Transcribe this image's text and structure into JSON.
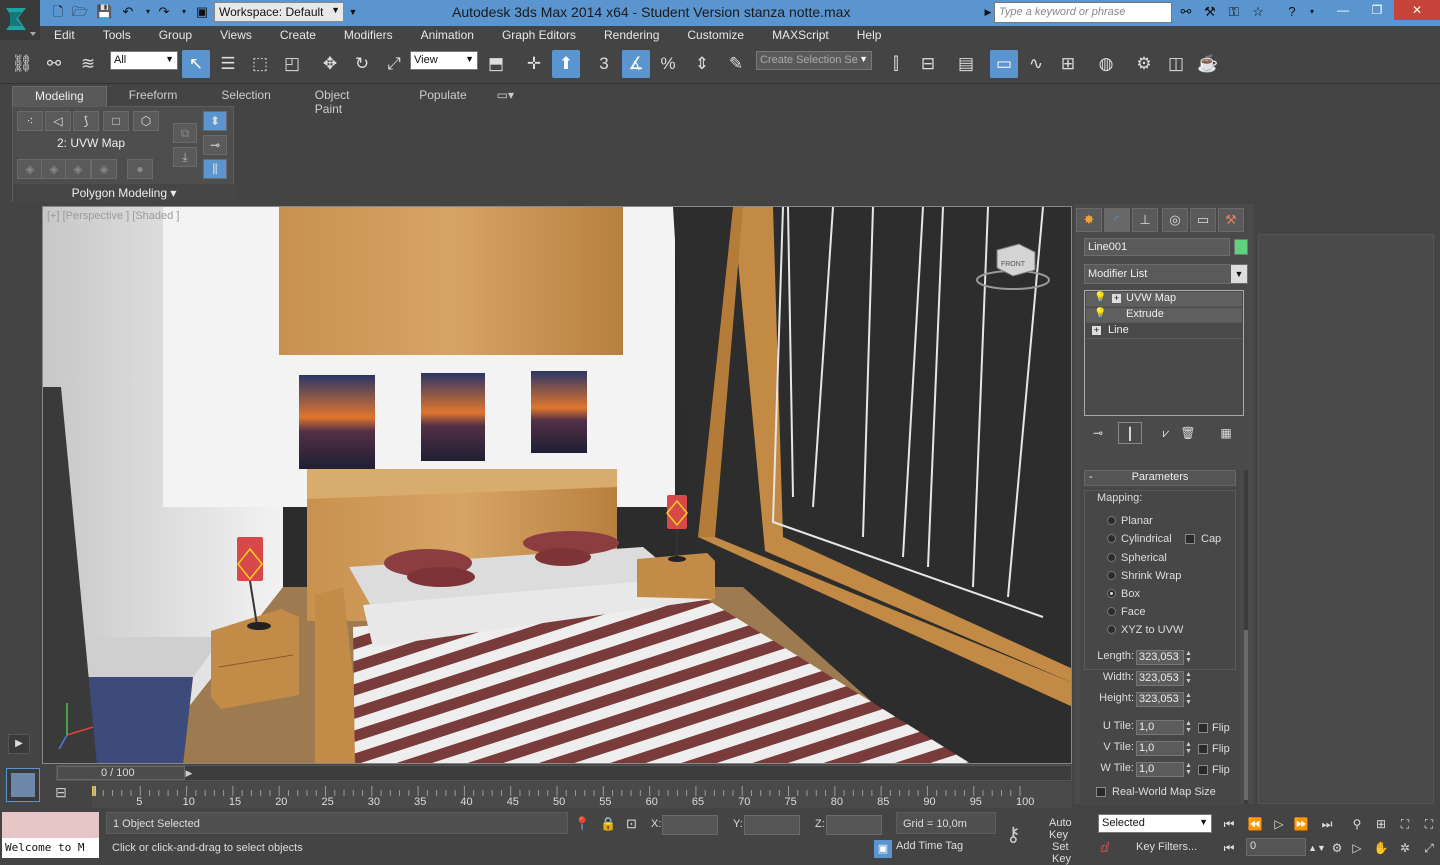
{
  "titlebar": {
    "title": "Autodesk 3ds Max  2014 x64   - Student Version    stanza notte.max",
    "workspace": "Workspace: Default",
    "search_placeholder": "Type a keyword or phrase"
  },
  "menu": [
    "Edit",
    "Tools",
    "Group",
    "Views",
    "Create",
    "Modifiers",
    "Animation",
    "Graph Editors",
    "Rendering",
    "Customize",
    "MAXScript",
    "Help"
  ],
  "toolbar": {
    "filter": "All",
    "ref_coord": "View",
    "snap_3": "3",
    "selection_set_placeholder": "Create Selection Se"
  },
  "ribbon": {
    "tabs": [
      "Modeling",
      "Freeform",
      "Selection",
      "Object Paint",
      "Populate"
    ],
    "active_tab": "Modeling",
    "modifier_label": "2: UVW Map",
    "panel_label": "Polygon Modeling"
  },
  "viewport": {
    "label": "[+] [Perspective ] [Shaded ]",
    "accent": "#5b95cf"
  },
  "command_panel": {
    "object_name": "Line001",
    "object_color": "#5fd27e",
    "modifier_list": "Modifier List",
    "stack": [
      "UVW Map",
      "Extrude",
      "Line"
    ],
    "params_title": "Parameters",
    "mapping_label": "Mapping:",
    "mapping_options": [
      "Planar",
      "Cylindrical",
      "Spherical",
      "Shrink Wrap",
      "Box",
      "Face",
      "XYZ to UVW"
    ],
    "mapping_selected": "Box",
    "cap_label": "Cap",
    "length_label": "Length:",
    "length": "323,053",
    "width_label": "Width:",
    "width": "323,053",
    "height_label": "Height:",
    "height": "323,053",
    "utile_label": "U Tile:",
    "utile": "1,0",
    "vtile_label": "V Tile:",
    "vtile": "1,0",
    "wtile_label": "W Tile:",
    "wtile": "1,0",
    "flip_label": "Flip",
    "realworld_label": "Real-World Map Size"
  },
  "timeline": {
    "slider_label": "0 / 100",
    "ticks": [
      "5",
      "10",
      "15",
      "20",
      "25",
      "30",
      "35",
      "40",
      "45",
      "50",
      "55",
      "60",
      "65",
      "70",
      "75",
      "80",
      "85",
      "90",
      "95",
      "100"
    ]
  },
  "status": {
    "maxscript": "Welcome to M",
    "selected": "1 Object Selected",
    "prompt": "Click or click-and-drag to select objects",
    "x_label": "X:",
    "y_label": "Y:",
    "z_label": "Z:",
    "grid": "Grid = 10,0m",
    "time_tag": "Add Time Tag",
    "auto_key": "Auto Key",
    "set_key": "Set Key",
    "key_mode": "Selected",
    "key_filters": "Key Filters...",
    "frame": "0"
  }
}
